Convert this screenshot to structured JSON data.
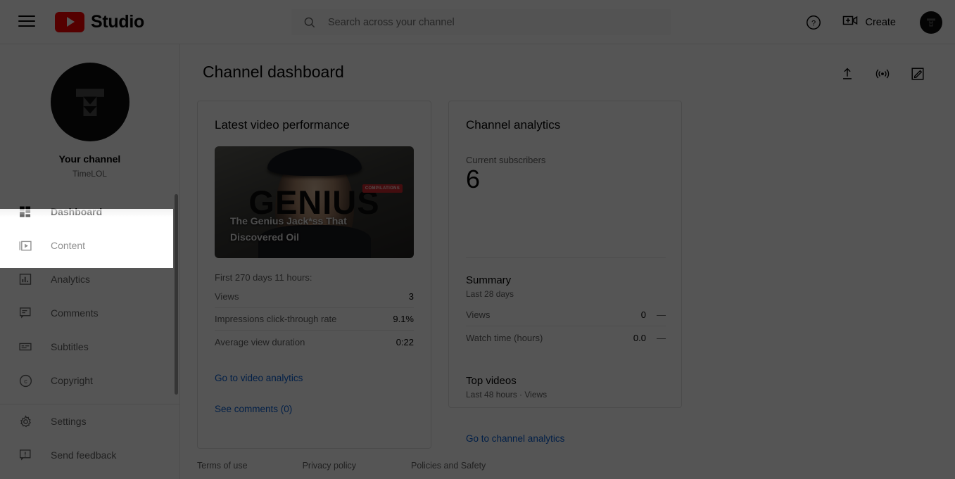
{
  "app": {
    "brand": "Studio",
    "logo_color": "#ff0000",
    "link_color": "#065fd4"
  },
  "topbar": {
    "menu_icon": "hamburger-icon",
    "search": {
      "placeholder": "Search across your channel",
      "value": "",
      "icon": "search-icon"
    },
    "help_icon": "help-circle-icon",
    "create": {
      "label": "Create",
      "icon": "video-plus-icon"
    },
    "avatar": "account-avatar"
  },
  "sidebar": {
    "channel": {
      "avatar": "channel-avatar",
      "title": "Your channel",
      "name": "TimeLOL"
    },
    "items": [
      {
        "label": "Dashboard",
        "icon": "dashboard-grid-icon",
        "active": false
      },
      {
        "label": "Content",
        "icon": "content-play-box-icon",
        "active": true
      },
      {
        "label": "Analytics",
        "icon": "analytics-bar-icon",
        "active": false
      },
      {
        "label": "Comments",
        "icon": "comment-bubble-icon",
        "active": false
      },
      {
        "label": "Subtitles",
        "icon": "subtitles-icon",
        "active": false
      },
      {
        "label": "Copyright",
        "icon": "copyright-icon",
        "active": false
      }
    ],
    "footer_items": [
      {
        "label": "Settings",
        "icon": "gear-icon"
      },
      {
        "label": "Send feedback",
        "icon": "feedback-bubble-icon"
      }
    ]
  },
  "main": {
    "page_title": "Channel dashboard",
    "actions": [
      {
        "name": "upload-videos-button",
        "icon": "upload-arrow-icon"
      },
      {
        "name": "go-live-button",
        "icon": "broadcast-live-icon"
      },
      {
        "name": "create-post-button",
        "icon": "pencil-square-icon"
      }
    ],
    "latest_video": {
      "heading": "Latest video performance",
      "thumbnail": {
        "overlay_text": "GENIUS",
        "badge": "COMPILATIONS",
        "title": "The Genius Jack*ss That Discovered Oil"
      },
      "period_label": "First 270 days 11 hours:",
      "stats": [
        {
          "label": "Views",
          "value": "3"
        },
        {
          "label": "Impressions click-through rate",
          "value": "9.1%"
        },
        {
          "label": "Average view duration",
          "value": "0:22"
        }
      ],
      "buttons": [
        "Go to video analytics",
        "See comments (0)"
      ]
    },
    "channel_analytics": {
      "heading": "Channel analytics",
      "subscribers_label": "Current subscribers",
      "subscribers_value": "6",
      "summary": {
        "heading": "Summary",
        "subtitle": "Last 28 days",
        "rows": [
          {
            "label": "Views",
            "value": "0",
            "delta": "—"
          },
          {
            "label": "Watch time (hours)",
            "value": "0.0",
            "delta": "—"
          }
        ]
      },
      "top_videos": {
        "heading": "Top videos",
        "subtitle": "Last 48 hours · Views"
      },
      "button": "Go to channel analytics"
    },
    "footer_links": [
      "Terms of use",
      "Privacy policy",
      "Policies and Safety"
    ]
  }
}
